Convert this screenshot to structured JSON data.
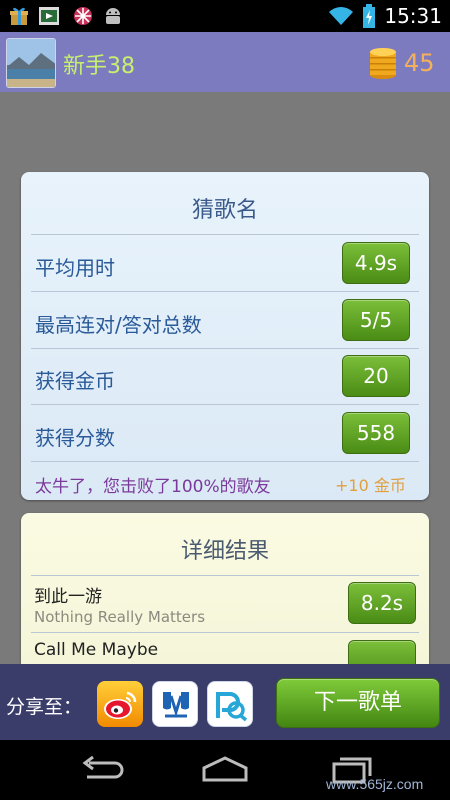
{
  "status_bar": {
    "time": "15:31",
    "icons": [
      "gift-icon",
      "film-icon",
      "pinwheel-icon",
      "android-icon",
      "wifi-icon",
      "battery-charging-icon"
    ]
  },
  "header": {
    "username": "新手38",
    "coins": "45",
    "avatar_icon": "landscape-avatar",
    "coin_icon": "coin-stack-icon",
    "colors": {
      "background": "#7d7bc0",
      "username": "#c7f06f",
      "coins": "#f4b05a"
    }
  },
  "stats_card": {
    "title": "猜歌名",
    "rows": [
      {
        "label": "平均用时",
        "value": "4.9s"
      },
      {
        "label": "最高连对/答对总数",
        "value": "5/5"
      },
      {
        "label": "获得金币",
        "value": "20"
      },
      {
        "label": "获得分数",
        "value": "558"
      }
    ],
    "footer_message": "太牛了，您击败了100%的歌友",
    "bonus": "+10 金币"
  },
  "detail_card": {
    "title": "详细结果",
    "songs": [
      {
        "title": "到此一游",
        "artist": "Nothing Really Matters",
        "time": "8.2s"
      },
      {
        "title": "Call Me Maybe",
        "artist": "",
        "time": ""
      }
    ]
  },
  "bottom_bar": {
    "share_label": "分享至：",
    "share_targets": [
      "weibo-icon",
      "renren-icon",
      "qzone-icon"
    ],
    "next_button": "下一歌单"
  },
  "nav_bar": {
    "icons": [
      "back-icon",
      "home-icon",
      "recent-apps-icon"
    ]
  },
  "watermark": "www.565jz.com"
}
